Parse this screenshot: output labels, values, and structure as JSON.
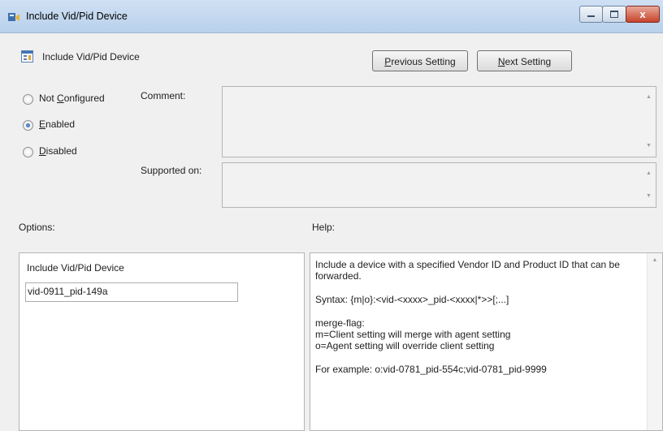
{
  "window": {
    "title": "Include Vid/Pid Device",
    "controls": {
      "minimize": "minimize",
      "maximize": "maximize",
      "close": "x"
    }
  },
  "header": {
    "setting_name": "Include Vid/Pid Device",
    "prev_button": {
      "accel": "P",
      "rest": "revious Setting"
    },
    "next_button": {
      "accel": "N",
      "rest": "ext Setting"
    }
  },
  "state_options": [
    {
      "pre": "Not ",
      "accel": "C",
      "rest": "onfigured",
      "selected": false
    },
    {
      "pre": "",
      "accel": "E",
      "rest": "nabled",
      "selected": true
    },
    {
      "pre": "",
      "accel": "D",
      "rest": "isabled",
      "selected": false
    }
  ],
  "comment": {
    "label": "Comment:",
    "value": ""
  },
  "supported_on": {
    "label": "Supported on:",
    "value": ""
  },
  "options": {
    "label": "Options:",
    "field_label": "Include Vid/Pid Device",
    "field_value": "vid-0911_pid-149a"
  },
  "help": {
    "label": "Help:",
    "paragraphs": [
      "Include a device with a specified Vendor ID and Product ID that can be forwarded.",
      "Syntax: {m|o}:<vid-<xxxx>_pid-<xxxx|*>>[;...]",
      "merge-flag:\nm=Client setting will merge with agent setting\no=Agent setting will override client setting",
      "For example: o:vid-0781_pid-554c;vid-0781_pid-9999"
    ]
  },
  "colors": {
    "title_bar": "#c4d8ef",
    "close_button": "#c6432a",
    "radio_selected": "#1b4fa0"
  },
  "icons": {
    "window": "policy-window-icon",
    "setting": "policy-setting-icon"
  }
}
